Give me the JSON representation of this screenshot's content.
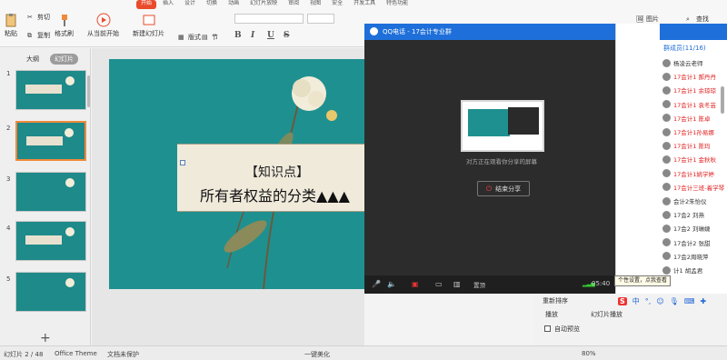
{
  "ribbon": {
    "tabs": [
      "开始",
      "插入",
      "设计",
      "切换",
      "动画",
      "幻灯片放映",
      "审阅",
      "视图",
      "安全",
      "开发工具",
      "特色功能"
    ],
    "buttons": {
      "cut": "剪切",
      "paste": "粘贴",
      "copy": "复制",
      "format_painter": "格式刷",
      "play_from_current": "从当前开始",
      "new_slide": "新建幻灯片",
      "layout": "版式",
      "section": "节",
      "picture": "图片",
      "find": "查找"
    },
    "format_glyphs": [
      "B",
      "I",
      "U",
      "S"
    ]
  },
  "left_panel": {
    "tabs": [
      "大纲",
      "幻灯片"
    ],
    "slide_numbers": [
      "1",
      "2",
      "3",
      "4",
      "5"
    ],
    "add_label": "+"
  },
  "slide": {
    "line1": "【知识点】",
    "line2": "所有者权益的分类▲▲▲"
  },
  "qq_window": {
    "title": "QQ电话 - 17会计专业群",
    "message": "对方正在观看你分享的屏幕",
    "stop_button": "结束分享",
    "call_time": "05:40",
    "toolbar_text": "置顶"
  },
  "members": {
    "count_label": "群成员(11/16)",
    "list": [
      {
        "name": "杨凌云老师",
        "style": "dark"
      },
      {
        "name": "17会计1 郝丹丹",
        "style": "red"
      },
      {
        "name": "17会计1 余琼琼",
        "style": "red"
      },
      {
        "name": "17会计1 袁冬芸",
        "style": "red"
      },
      {
        "name": "17会计1 陈卓",
        "style": "red"
      },
      {
        "name": "17会计1孙易娜",
        "style": "red"
      },
      {
        "name": "17会计1 陈玛",
        "style": "red"
      },
      {
        "name": "17会计1 金秋秋",
        "style": "red"
      },
      {
        "name": "17会计1姚学婷",
        "style": "red"
      },
      {
        "name": "17会计三班-着学琴",
        "style": "red"
      },
      {
        "name": "会计2朱怡仪",
        "style": "dark"
      },
      {
        "name": "17会2 刘燕",
        "style": "dark"
      },
      {
        "name": "17会2 刘琳婕",
        "style": "dark"
      },
      {
        "name": "17会计2 张甜",
        "style": "dark"
      },
      {
        "name": "17会2周晓萍",
        "style": "dark"
      },
      {
        "name": "计1 胡孟君",
        "style": "dark"
      }
    ]
  },
  "tooltip": "个性设置，点我查看",
  "right_panel": {
    "play_label": "播放",
    "slideshow_label": "幻灯片播放",
    "auto_preview": "自动预览",
    "order_label": "重新排序"
  },
  "status_bar": {
    "slide_info": "幻灯片 2 / 48",
    "theme": "Office Theme",
    "doc_protect": "文档未保护",
    "beautify": "一键美化",
    "zoom": "80%"
  },
  "colors": {
    "ribbon_accent": "#e94b2b",
    "slide_bg": "#1f9090",
    "qq_blue": "#1e6fd9",
    "member_red": "#e02020"
  }
}
